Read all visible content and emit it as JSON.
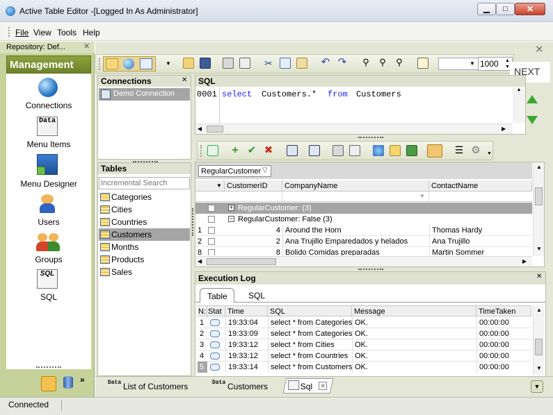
{
  "window": {
    "title": "Active Table Editor -[Logged In As Administrator]"
  },
  "menu": [
    "File",
    "View",
    "Tools",
    "Help"
  ],
  "repository": {
    "label": "Repository: Def..."
  },
  "management": {
    "title": "Management",
    "items": [
      {
        "label": "Connections",
        "icon": "globe-icon"
      },
      {
        "label": "Menu Items",
        "icon": "data-icon"
      },
      {
        "label": "Menu Designer",
        "icon": "designer-icon"
      },
      {
        "label": "Users",
        "icon": "user-icon"
      },
      {
        "label": "Groups",
        "icon": "group-icon"
      },
      {
        "label": "SQL",
        "icon": "sql-icon"
      }
    ]
  },
  "toolbar": {
    "row_limit": "1000",
    "next_label": "NEXT"
  },
  "connections": {
    "title": "Connections",
    "items": [
      "Demo Connection"
    ]
  },
  "tables": {
    "title": "Tables",
    "search_placeholder": "Incremental Search",
    "items": [
      "Categories",
      "Cities",
      "Countries",
      "Customers",
      "Months",
      "Products",
      "Sales"
    ],
    "selected": "Customers"
  },
  "sql": {
    "title": "SQL",
    "line_number": "0001",
    "kw1": "select",
    "mid": "Customers.*",
    "kw2": "from",
    "tbl": "Customers"
  },
  "grid": {
    "group_by": "RegularCustomer",
    "columns": [
      "CustomerID",
      "CompanyName",
      "ContactName"
    ],
    "group_true": "RegularCustomer:  (3)",
    "group_false": "RegularCustomer: False (3)",
    "rows": [
      {
        "n": "1",
        "id": "4",
        "company": "Around the Horn",
        "contact": "Thomas Hardy"
      },
      {
        "n": "2",
        "id": "2",
        "company": "Ana Trujillo Emparedados y helados",
        "contact": "Ana Trujillo"
      },
      {
        "n": "8",
        "id": "8",
        "company": "Bolido Comidas preparadas",
        "contact": "Martin Sommer"
      }
    ]
  },
  "execlog": {
    "title": "Execution Log",
    "tabs": [
      "Table",
      "SQL"
    ],
    "columns": [
      "N:",
      "Stat",
      "Time",
      "SQL",
      "Message",
      "TimeTaken"
    ],
    "rows": [
      {
        "n": "1",
        "time": "19:33:04",
        "sql": "select * from Categories",
        "msg": "OK.",
        "taken": "00:00:00"
      },
      {
        "n": "2",
        "time": "19:33:09",
        "sql": "select * from Categories",
        "msg": "OK.",
        "taken": "00:00:00"
      },
      {
        "n": "3",
        "time": "19:33:12",
        "sql": "select * from Cities",
        "msg": "OK.",
        "taken": "00:00:00"
      },
      {
        "n": "4",
        "time": "19:33:12",
        "sql": "select * from Countries",
        "msg": "OK.",
        "taken": "00:00:00"
      },
      {
        "n": "5",
        "time": "19:33:14",
        "sql": "select * from Customers",
        "msg": "OK.",
        "taken": "00:00:00"
      }
    ]
  },
  "doc_tabs": [
    "List of Customers",
    "Customers",
    "Sql"
  ],
  "status": {
    "text": "Connected"
  },
  "colors": {
    "sidebar": "#c6d29a",
    "management": "#7d9133",
    "accent": "#cdd6a8",
    "selection": "#a5a5a5"
  }
}
